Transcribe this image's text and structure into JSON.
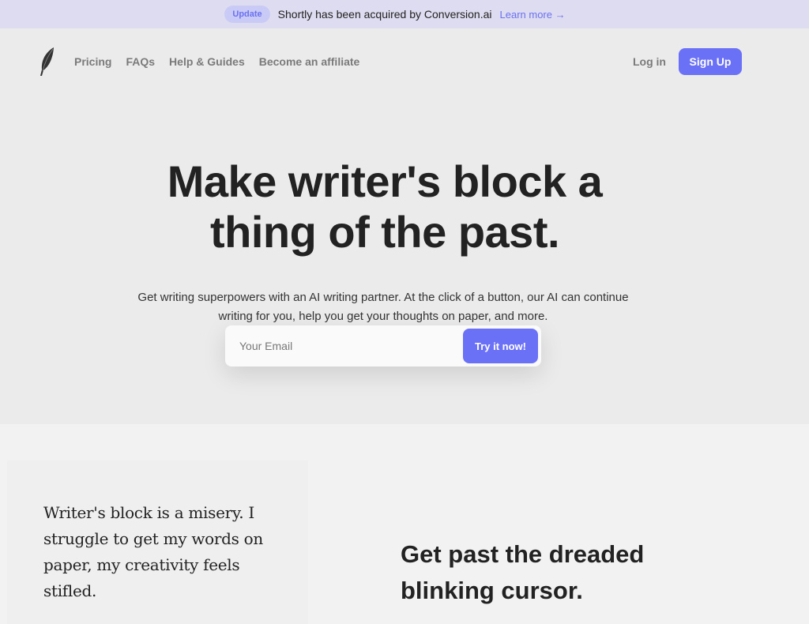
{
  "banner": {
    "badge": "Update",
    "text": "Shortly has been acquired by Conversion.ai",
    "link": "Learn more →"
  },
  "nav": {
    "logo_icon": "feather-icon",
    "links": [
      "Pricing",
      "FAQs",
      "Help & Guides",
      "Become an affiliate"
    ],
    "login": "Log in",
    "signup": "Sign Up"
  },
  "hero": {
    "headline_line1": "Make writer's block a",
    "headline_line2": "thing of the past.",
    "subtitle_line1": "Get writing superpowers with an AI writing partner. At the click of a button, our AI can continue",
    "subtitle_line2": "writing for you, help you get your thoughts on paper, and more.",
    "email_placeholder": "Your Email",
    "email_value": "",
    "cta": "Try it now!"
  },
  "section2": {
    "quote": "Writer's block is a misery. I struggle to get my words on paper, my creativity feels stifled.",
    "heading": "Get past the dreaded blinking cursor."
  },
  "colors": {
    "accent": "#6b71f7",
    "banner_bg": "#dedcf0",
    "hero_bg": "#ebebeb"
  }
}
